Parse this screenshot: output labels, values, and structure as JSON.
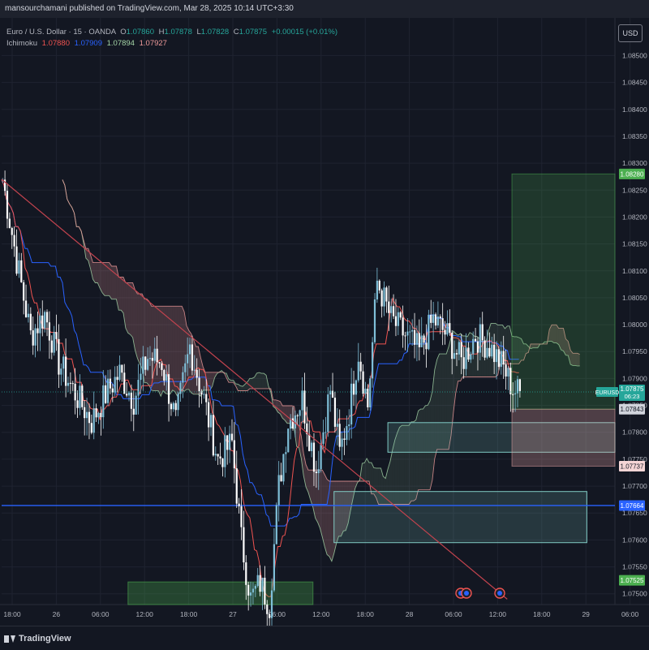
{
  "header": {
    "publisher_line": "mansourchamani published on TradingView.com, Mar 28, 2025 10:14 UTC+3:30"
  },
  "legend": {
    "symbol": "Euro / U.S. Dollar · 15 · OANDA",
    "o_label": "O",
    "o_value": "1.07860",
    "h_label": "H",
    "h_value": "1.07878",
    "l_label": "L",
    "l_value": "1.07828",
    "c_label": "C",
    "c_value": "1.07875",
    "change": "+0.00015 (+0.01%)",
    "ichimoku_label": "Ichimoku",
    "ichimoku_values": [
      "1.07880",
      "1.07909",
      "1.07894",
      "1.07927"
    ]
  },
  "currency_button": "USD",
  "footer": {
    "brand": "TradingView"
  },
  "colors": {
    "background": "#131722",
    "up": "#7fbfd8",
    "down": "#ffffff",
    "tenkan": "#ef5350",
    "kijun": "#2962ff",
    "span_a": "#a5d6a7",
    "span_b": "#ef9a9a",
    "trendline": "#c2434e",
    "horizontal_line": "#2962ff",
    "profit_zone": "#4caf50",
    "loss_zone": "#e8a4a4",
    "box_zone": "#80cbc4"
  },
  "chart_data": {
    "type": "candlestick",
    "symbol": "EURUSD",
    "timeframe": "15",
    "ylim": [
      1.0748,
      1.0857
    ],
    "x_ticks": [
      "18:00",
      "26",
      "06:00",
      "12:00",
      "18:00",
      "27",
      "06:00",
      "12:00",
      "18:00",
      "28",
      "06:00",
      "12:00",
      "18:00",
      "29",
      "06:00"
    ],
    "y_ticks": [
      "1.08500",
      "1.08450",
      "1.08400",
      "1.08350",
      "1.08300",
      "1.08250",
      "1.08200",
      "1.08150",
      "1.08100",
      "1.08050",
      "1.08000",
      "1.07950",
      "1.07900",
      "1.07850",
      "1.07800",
      "1.07750",
      "1.07700",
      "1.07650",
      "1.07600",
      "1.07550",
      "1.07500"
    ],
    "price_path": [
      [
        0,
        1.0827
      ],
      [
        6,
        1.0812
      ],
      [
        12,
        1.0798
      ],
      [
        18,
        1.0802
      ],
      [
        24,
        1.0793
      ],
      [
        30,
        1.0788
      ],
      [
        38,
        1.0782
      ],
      [
        44,
        1.0787
      ],
      [
        50,
        1.0791
      ],
      [
        56,
        1.0786
      ],
      [
        62,
        1.0794
      ],
      [
        68,
        1.0793
      ],
      [
        74,
        1.0782
      ],
      [
        80,
        1.0796
      ],
      [
        86,
        1.0786
      ],
      [
        92,
        1.0775
      ],
      [
        98,
        1.0778
      ],
      [
        102,
        1.076
      ],
      [
        106,
        1.0749
      ],
      [
        110,
        1.0752
      ],
      [
        114,
        1.0748
      ],
      [
        118,
        1.077
      ],
      [
        122,
        1.0782
      ],
      [
        128,
        1.0786
      ],
      [
        134,
        1.0773
      ],
      [
        140,
        1.0788
      ],
      [
        144,
        1.0776
      ],
      [
        148,
        1.0784
      ],
      [
        152,
        1.0795
      ],
      [
        156,
        1.0785
      ],
      [
        160,
        1.0808
      ],
      [
        166,
        1.0801
      ],
      [
        172,
        1.0798
      ],
      [
        178,
        1.0795
      ],
      [
        184,
        1.0801
      ],
      [
        190,
        1.0798
      ],
      [
        196,
        1.0793
      ],
      [
        202,
        1.0798
      ],
      [
        208,
        1.0796
      ],
      [
        214,
        1.0792
      ],
      [
        218,
        1.0788
      ],
      [
        222,
        1.0787
      ]
    ],
    "current_price": "1.07875",
    "countdown": "06:23",
    "symbol_tag": "EURUSD",
    "price_labels": [
      {
        "text": "1.08280",
        "price": 1.0828,
        "style": "profit"
      },
      {
        "text": "1.07843",
        "price": 1.07843,
        "style": "neutral"
      },
      {
        "text": "1.07737",
        "price": 1.07737,
        "style": "loss"
      },
      {
        "text": "1.07664",
        "price": 1.07664,
        "style": "line"
      },
      {
        "text": "1.07525",
        "price": 1.07525,
        "style": "profit"
      }
    ],
    "drawings": {
      "trendline": {
        "from": [
          0,
          1.0827
        ],
        "to": [
          216,
          1.0749
        ]
      },
      "horizontal_line": 1.07664,
      "long_position": {
        "start": 218,
        "end": 262,
        "entry": 1.07843,
        "target": 1.0828,
        "stop": 1.07737
      },
      "zones": [
        {
          "start": 165,
          "end": 262,
          "top": 1.07818,
          "bottom": 1.07763
        },
        {
          "start": 142,
          "end": 250,
          "top": 1.0769,
          "bottom": 1.07595
        },
        {
          "start": 54,
          "end": 133,
          "top": 1.07522,
          "bottom": 1.0748
        }
      ]
    },
    "grid": true
  }
}
